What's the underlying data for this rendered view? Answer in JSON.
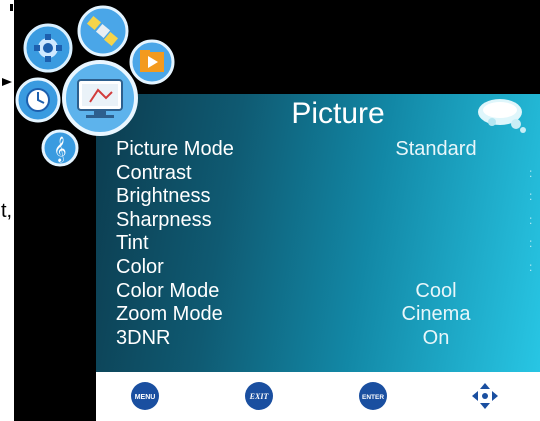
{
  "menu": {
    "title": "Picture",
    "items": [
      {
        "label": "Picture Mode",
        "value": "Standard",
        "dot": ""
      },
      {
        "label": "Contrast",
        "value": "",
        "dot": ":"
      },
      {
        "label": "Brightness",
        "value": "",
        "dot": ":"
      },
      {
        "label": "Sharpness",
        "value": "",
        "dot": ":"
      },
      {
        "label": "Tint",
        "value": "",
        "dot": ":"
      },
      {
        "label": "Color",
        "value": "",
        "dot": ":"
      },
      {
        "label": "Color Mode",
        "value": "Cool",
        "dot": ""
      },
      {
        "label": "Zoom Mode",
        "value": "Cinema",
        "dot": ""
      },
      {
        "label": "3DNR",
        "value": "On",
        "dot": ""
      }
    ]
  },
  "bottom_bar": {
    "menu_label": "MENU",
    "exit_label": "EXIT",
    "enter_label": "ENTER"
  },
  "stray": {
    "text": "t,"
  },
  "icons": [
    "settings-gear-icon",
    "satellite-icon",
    "media-folder-icon",
    "clock-icon",
    "picture-monitor-icon",
    "music-note-icon",
    "speech-bubble-icon",
    "navigate-arrows-icon"
  ],
  "colors": {
    "panel_dark": "#0c3c4f",
    "panel_light": "#28c6e4",
    "button_blue": "#1a4fa0"
  }
}
